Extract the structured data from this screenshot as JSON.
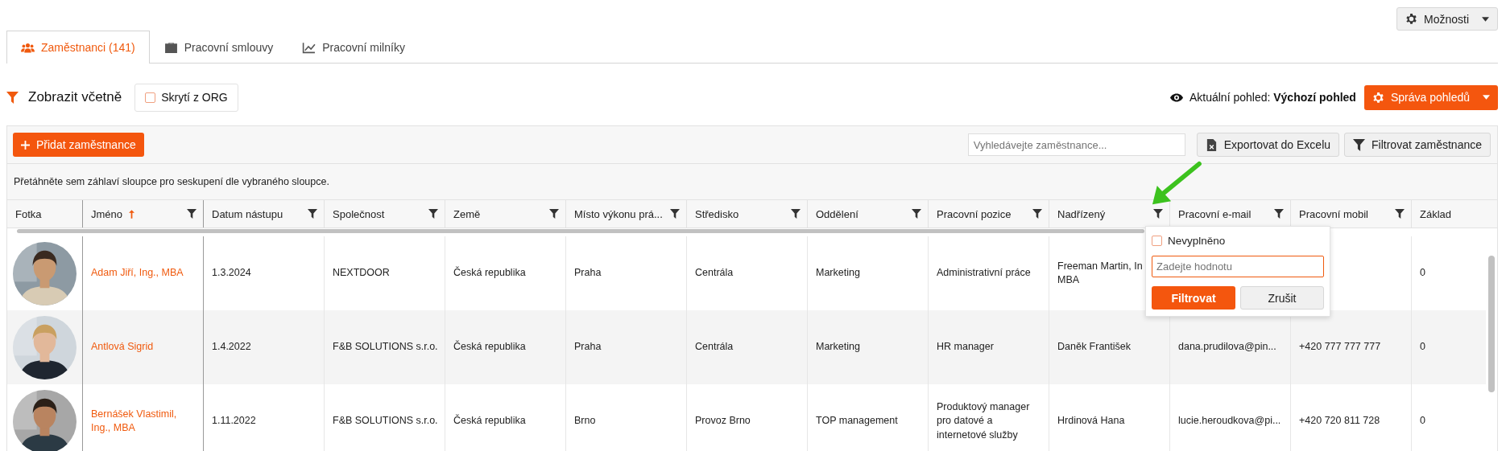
{
  "options_button": {
    "label": "Možnosti"
  },
  "tabs": [
    {
      "label": "Zaměstnanci (141)",
      "selected": true
    },
    {
      "label": "Pracovní smlouvy",
      "selected": false
    },
    {
      "label": "Pracovní milníky",
      "selected": false
    }
  ],
  "view_bar": {
    "title": "Zobrazit včetně",
    "hidden_checkbox": {
      "label": "Skrytí z ORG",
      "checked": false
    },
    "current_view_label": "Aktuální pohled:",
    "current_view": "Výchozí pohled",
    "manage_button": "Správa pohledů"
  },
  "toolbar": {
    "add_button": "Přidat zaměstnance",
    "search": {
      "placeholder": "Vyhledávejte zaměstnance..."
    },
    "export_button": "Exportovat do Excelu",
    "filter_button": "Filtrovat zaměstnance"
  },
  "group_hint": "Přetáhněte sem záhlaví sloupce pro seskupení dle vybraného sloupce.",
  "table": {
    "columns": [
      {
        "label": "Fotka",
        "filterable": false,
        "sorted": false
      },
      {
        "label": "Jméno",
        "filterable": true,
        "sorted": true
      },
      {
        "label": "Datum nástupu",
        "filterable": true,
        "sorted": false
      },
      {
        "label": "Společnost",
        "filterable": true,
        "sorted": false
      },
      {
        "label": "Země",
        "filterable": true,
        "sorted": false
      },
      {
        "label": "Místo výkonu prá...",
        "filterable": true,
        "sorted": false
      },
      {
        "label": "Středisko",
        "filterable": true,
        "sorted": false
      },
      {
        "label": "Oddělení",
        "filterable": true,
        "sorted": false
      },
      {
        "label": "Pracovní pozice",
        "filterable": true,
        "sorted": false
      },
      {
        "label": "Nadřízený",
        "filterable": true,
        "sorted": false
      },
      {
        "label": "Pracovní e-mail",
        "filterable": true,
        "sorted": false
      },
      {
        "label": "Pracovní mobil",
        "filterable": true,
        "sorted": false
      },
      {
        "label": "Základ",
        "filterable": false,
        "sorted": false
      }
    ],
    "rows": [
      {
        "cells": [
          "",
          "Adam Jiří, Ing., MBA",
          "1.3.2024",
          "NEXTDOOR",
          "Česká republika",
          "Praha",
          "Centrála",
          "Marketing",
          "Administrativní práce",
          "Freeman Martin, In\nMBA",
          "",
          "",
          "0"
        ]
      },
      {
        "cells": [
          "",
          "Antlová Sigrid",
          "1.4.2022",
          "F&B SOLUTIONS s.r.o.",
          "Česká republika",
          "Praha",
          "Centrála",
          "Marketing",
          "HR manager",
          "Daněk František",
          "dana.prudilova@pin...",
          "+420 777 777 777",
          "0"
        ]
      },
      {
        "cells": [
          "",
          "Bernášek Vlastimil,\nIng., MBA",
          "1.11.2022",
          "F&B SOLUTIONS s.r.o.",
          "Česká republika",
          "Brno",
          "Provoz Brno",
          "TOP management",
          "Produktový manager\npro datové a\ninternetové služby",
          "Hrdinová Hana",
          "lucie.heroudkova@pi...",
          "+420 720 811 728",
          "0"
        ]
      }
    ]
  },
  "filter_popup": {
    "empty_checkbox": {
      "label": "Nevyplněno",
      "checked": false
    },
    "input": {
      "placeholder": "Zadejte hodnotu"
    },
    "apply_button": "Filtrovat",
    "cancel_button": "Zrušit"
  }
}
